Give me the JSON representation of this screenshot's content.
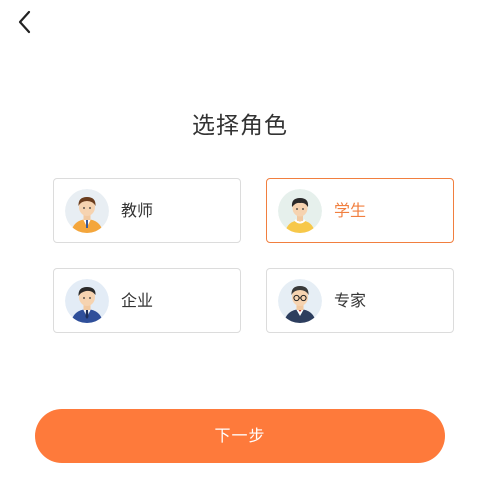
{
  "header": {
    "back_icon": "chevron-left-icon"
  },
  "main": {
    "title": "选择角色",
    "roles": [
      {
        "label": "教师",
        "avatar_icon": "teacher-avatar-icon",
        "selected": false
      },
      {
        "label": "学生",
        "avatar_icon": "student-avatar-icon",
        "selected": true
      },
      {
        "label": "企业",
        "avatar_icon": "company-avatar-icon",
        "selected": false
      },
      {
        "label": "专家",
        "avatar_icon": "expert-avatar-icon",
        "selected": false
      }
    ]
  },
  "footer": {
    "next_label": "下一步"
  },
  "colors": {
    "accent": "#fe7a3b",
    "selected_border": "#f17f3f",
    "card_border": "#dcdcdc",
    "text": "#333333"
  }
}
